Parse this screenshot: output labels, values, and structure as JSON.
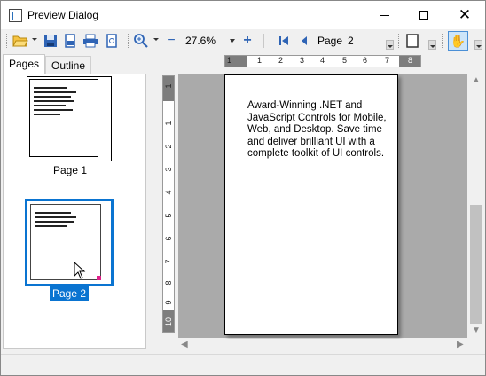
{
  "window": {
    "title": "Preview Dialog"
  },
  "toolbar": {
    "zoom_value": "27.6%",
    "page_label": "Page",
    "page_number": "2"
  },
  "tabs": [
    {
      "label": "Pages",
      "selected": true
    },
    {
      "label": "Outline",
      "selected": false
    }
  ],
  "thumbnails": [
    {
      "label": "Page 1",
      "selected": false
    },
    {
      "label": "Page 2",
      "selected": true
    }
  ],
  "rulers": {
    "horizontal_ticks": [
      "1",
      "1",
      "2",
      "3",
      "4",
      "5",
      "6",
      "7",
      "8"
    ],
    "vertical_ticks": [
      "1",
      "1",
      "2",
      "3",
      "4",
      "5",
      "6",
      "7",
      "8",
      "9",
      "10"
    ]
  },
  "document": {
    "text": "Award-Winning .NET and JavaScript Controls for Mobile, Web, and Desktop. Save time and deliver brilliant UI with a complete toolkit of UI controls."
  },
  "colors": {
    "selection": "#0a74d1",
    "canvas_background": "#aaaaaa"
  }
}
